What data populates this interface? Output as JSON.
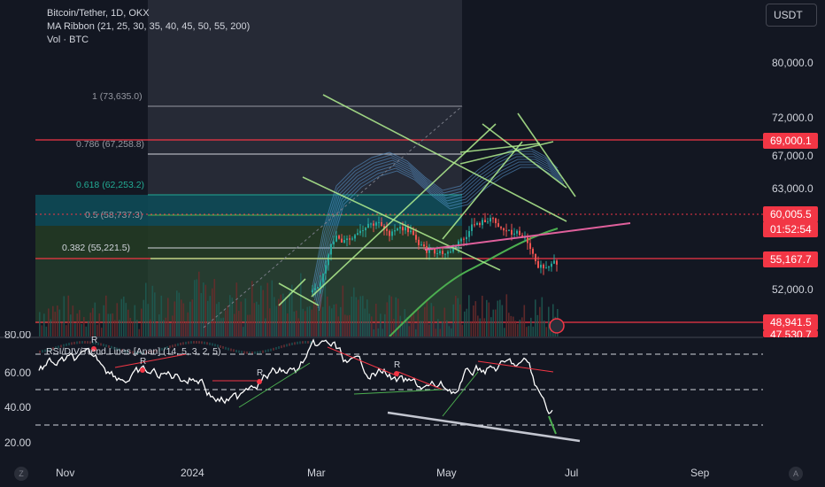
{
  "legend": {
    "symbol": "Bitcoin/Tether, 1D, OKX",
    "ma_ribbon": "MA Ribbon (21, 25, 30, 35, 40, 45, 50, 55, 200)",
    "volume": "Vol · BTC"
  },
  "currency_selector": "USDT",
  "rsi_indicator_label": "RSI/DIV/Trend Lines [Anan] (14, 5, 3, 2, 5)",
  "price_axis": {
    "ticks": [
      "80,000.0",
      "72,000.0",
      "67,000.0",
      "63,000.0",
      "52,000.0"
    ],
    "tags": [
      {
        "label": "69,000.1",
        "color": "#f23645"
      },
      {
        "label": "60,005.5",
        "color": "#f23645"
      },
      {
        "label": "01:52:54",
        "color": "#f23645"
      },
      {
        "label": "55,167.7",
        "color": "#f23645"
      },
      {
        "label": "48,941.5",
        "color": "#f23645"
      },
      {
        "label": "47,530.7",
        "color": "#f23645"
      }
    ]
  },
  "rsi_axis": {
    "ticks": [
      "80.00",
      "60.00",
      "40.00",
      "20.00"
    ]
  },
  "time_axis": {
    "ticks": [
      "Nov",
      "2024",
      "Mar",
      "May",
      "Jul",
      "Sep"
    ]
  },
  "fibonacci": {
    "levels": [
      {
        "label": "1 (73,635.0)",
        "color": "#9598a1"
      },
      {
        "label": "0.786 (67,258.8)",
        "color": "#9598a1"
      },
      {
        "label": "0.618 (62,253.2)",
        "color": "#22ab94"
      },
      {
        "label": "0.5 (58,737.3)",
        "color": "#9598a1"
      },
      {
        "label": "0.382 (55,221.5)",
        "color": "#d1d4dc"
      }
    ]
  },
  "rsi_markers": [
    "R",
    "R",
    "R",
    "R"
  ],
  "corner_buttons": {
    "left": "Z",
    "right": "A"
  },
  "colors": {
    "background": "#131722",
    "up": "#26a69a",
    "down": "#ef5350",
    "horizontal_line": "#f23645",
    "trendline": "#b2f090",
    "ribbon": "#5b9bd5",
    "ma200": "#4caf50",
    "support": "#e0609c"
  }
}
